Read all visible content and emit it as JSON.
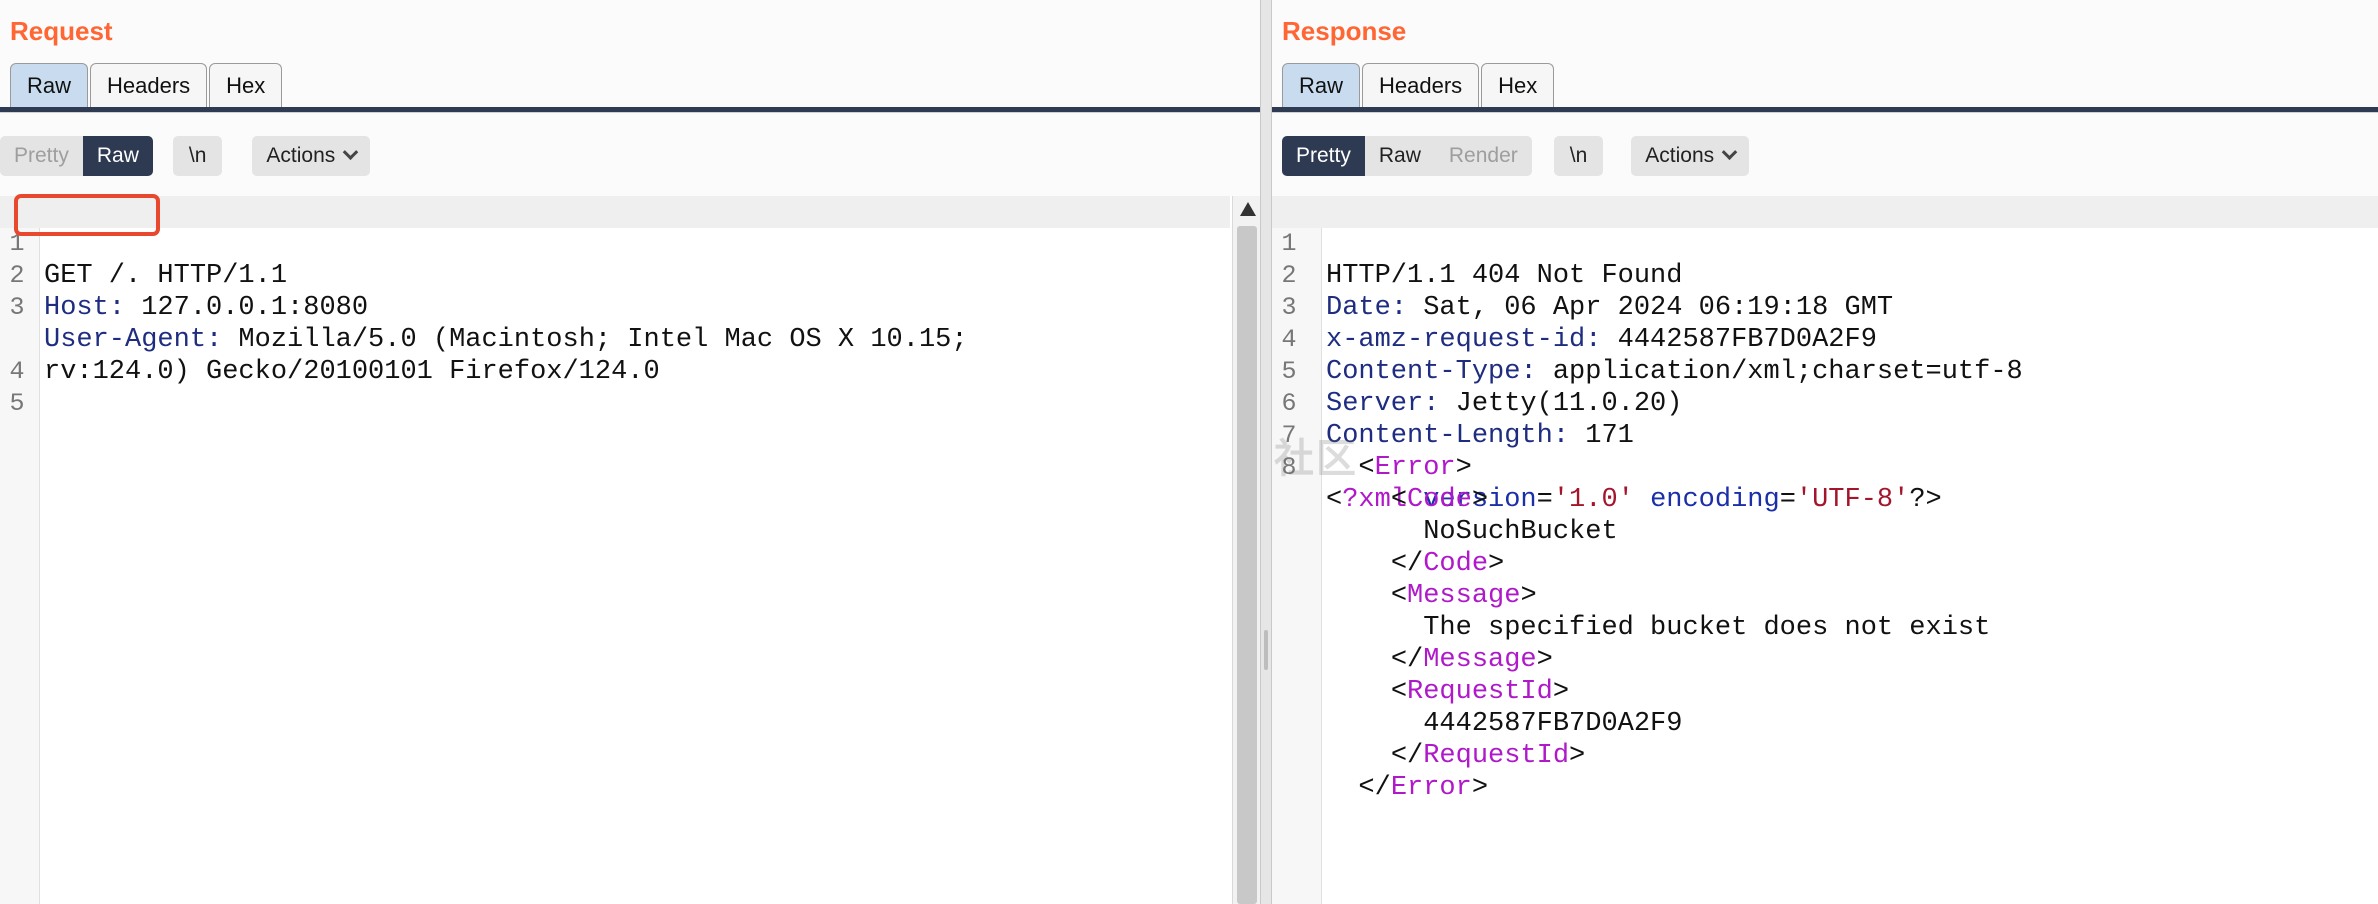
{
  "request": {
    "title": "Request",
    "tabs": [
      "Raw",
      "Headers",
      "Hex"
    ],
    "active_tab": "Raw",
    "view_modes": [
      "Pretty",
      "Raw"
    ],
    "active_mode": "Raw",
    "newline_label": "\\n",
    "actions_label": "Actions",
    "lines": [
      {
        "n": "1",
        "key": "GET /.",
        "sep": "",
        "rest": " HTTP/1.1"
      },
      {
        "n": "2",
        "key": "Host",
        "sep": ":",
        "rest": " 127.0.0.1:8080"
      },
      {
        "n": "3",
        "key": "User-Agent",
        "sep": ":",
        "rest": " Mozilla/5.0 (Macintosh; Intel Mac OS X 10.15;"
      },
      {
        "n": "",
        "key": "",
        "sep": "",
        "rest": "rv:124.0) Gecko/20100101 Firefox/124.0"
      },
      {
        "n": "4",
        "key": "",
        "sep": "",
        "rest": ""
      },
      {
        "n": "5",
        "key": "",
        "sep": "",
        "rest": ""
      }
    ]
  },
  "response": {
    "title": "Response",
    "tabs": [
      "Raw",
      "Headers",
      "Hex"
    ],
    "active_tab": "Raw",
    "view_modes": [
      "Pretty",
      "Raw",
      "Render"
    ],
    "active_mode": "Pretty",
    "newline_label": "\\n",
    "actions_label": "Actions",
    "status_line": "HTTP/1.1 404 Not Found",
    "headers": [
      {
        "n": "2",
        "key": "Date",
        "value": " Sat, 06 Apr 2024 06:19:18 GMT"
      },
      {
        "n": "3",
        "key": "x-amz-request-id",
        "value": " 4442587FB7D0A2F9"
      },
      {
        "n": "4",
        "key": "Content-Type",
        "value": " application/xml;charset=utf-8"
      },
      {
        "n": "5",
        "key": "Server",
        "value": " Jetty(11.0.20)"
      },
      {
        "n": "6",
        "key": "Content-Length",
        "value": " 171"
      }
    ],
    "blank_line_n": "7",
    "xml_line_n": "8",
    "xml_decl": {
      "name": "?xml",
      "attr1": "version",
      "val1": "'1.0'",
      "attr2": "encoding",
      "val2": "'UTF-8'",
      "end": "?>"
    },
    "xml_body": [
      {
        "indent": "  ",
        "open": "<",
        "tag": "Error",
        "close": ">"
      },
      {
        "indent": "    ",
        "open": "<",
        "tag": "Code",
        "close": ">"
      },
      {
        "indent": "      ",
        "text": "NoSuchBucket"
      },
      {
        "indent": "    ",
        "open": "</",
        "tag": "Code",
        "close": ">"
      },
      {
        "indent": "    ",
        "open": "<",
        "tag": "Message",
        "close": ">"
      },
      {
        "indent": "      ",
        "text": "The specified bucket does not exist"
      },
      {
        "indent": "    ",
        "open": "</",
        "tag": "Message",
        "close": ">"
      },
      {
        "indent": "    ",
        "open": "<",
        "tag": "RequestId",
        "close": ">"
      },
      {
        "indent": "      ",
        "text": "4442587FB7D0A2F9"
      },
      {
        "indent": "    ",
        "open": "</",
        "tag": "RequestId",
        "close": ">"
      },
      {
        "indent": "  ",
        "open": "</",
        "tag": "Error",
        "close": ">"
      }
    ]
  },
  "watermark": {
    "text": "奇安信攻防社区"
  },
  "colors": {
    "title": "#ff6633",
    "active_tab": "#c9dcef",
    "toggle_on": "#2e3a52",
    "highlight_box": "#e8492e",
    "header_key": "#1f2d80",
    "xml_tag": "#b019c9",
    "xml_attr": "#1b2fa8",
    "xml_string": "#a3152b"
  }
}
